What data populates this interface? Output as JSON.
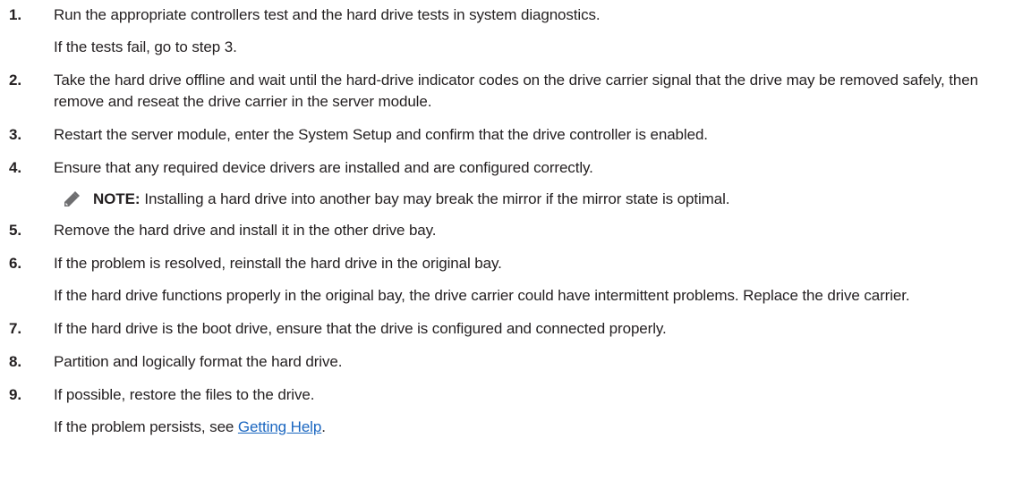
{
  "steps": [
    {
      "num": "1.",
      "text": "Run the appropriate controllers test and the hard drive tests in system diagnostics.",
      "sub": "If the tests fail, go to step 3."
    },
    {
      "num": "2.",
      "text": "Take the hard drive offline and wait until the hard-drive indicator codes on the drive carrier signal that the drive may be removed safely, then remove and reseat the drive carrier in the server module."
    },
    {
      "num": "3.",
      "text": "Restart the server module, enter the System Setup and confirm that the drive controller is enabled."
    },
    {
      "num": "4.",
      "text": "Ensure that any required device drivers are installed and are configured correctly."
    },
    {
      "num": "5.",
      "text": "Remove the hard drive and install it in the other drive bay."
    },
    {
      "num": "6.",
      "text": "If the problem is resolved, reinstall the hard drive in the original bay.",
      "sub": "If the hard drive functions properly in the original bay, the drive carrier could have intermittent problems. Replace the drive carrier."
    },
    {
      "num": "7.",
      "text": "If the hard drive is the boot drive, ensure that the drive is configured and connected properly."
    },
    {
      "num": "8.",
      "text": "Partition and logically format the hard drive."
    },
    {
      "num": "9.",
      "text": "If possible, restore the files to the drive.",
      "sub_prefix": "If the problem persists, see ",
      "sub_link": "Getting Help",
      "sub_suffix": "."
    }
  ],
  "note": {
    "icon": "note-pencil-icon",
    "label": "NOTE:",
    "text": "Installing a hard drive into another bay may break the mirror if the mirror state is optimal."
  }
}
